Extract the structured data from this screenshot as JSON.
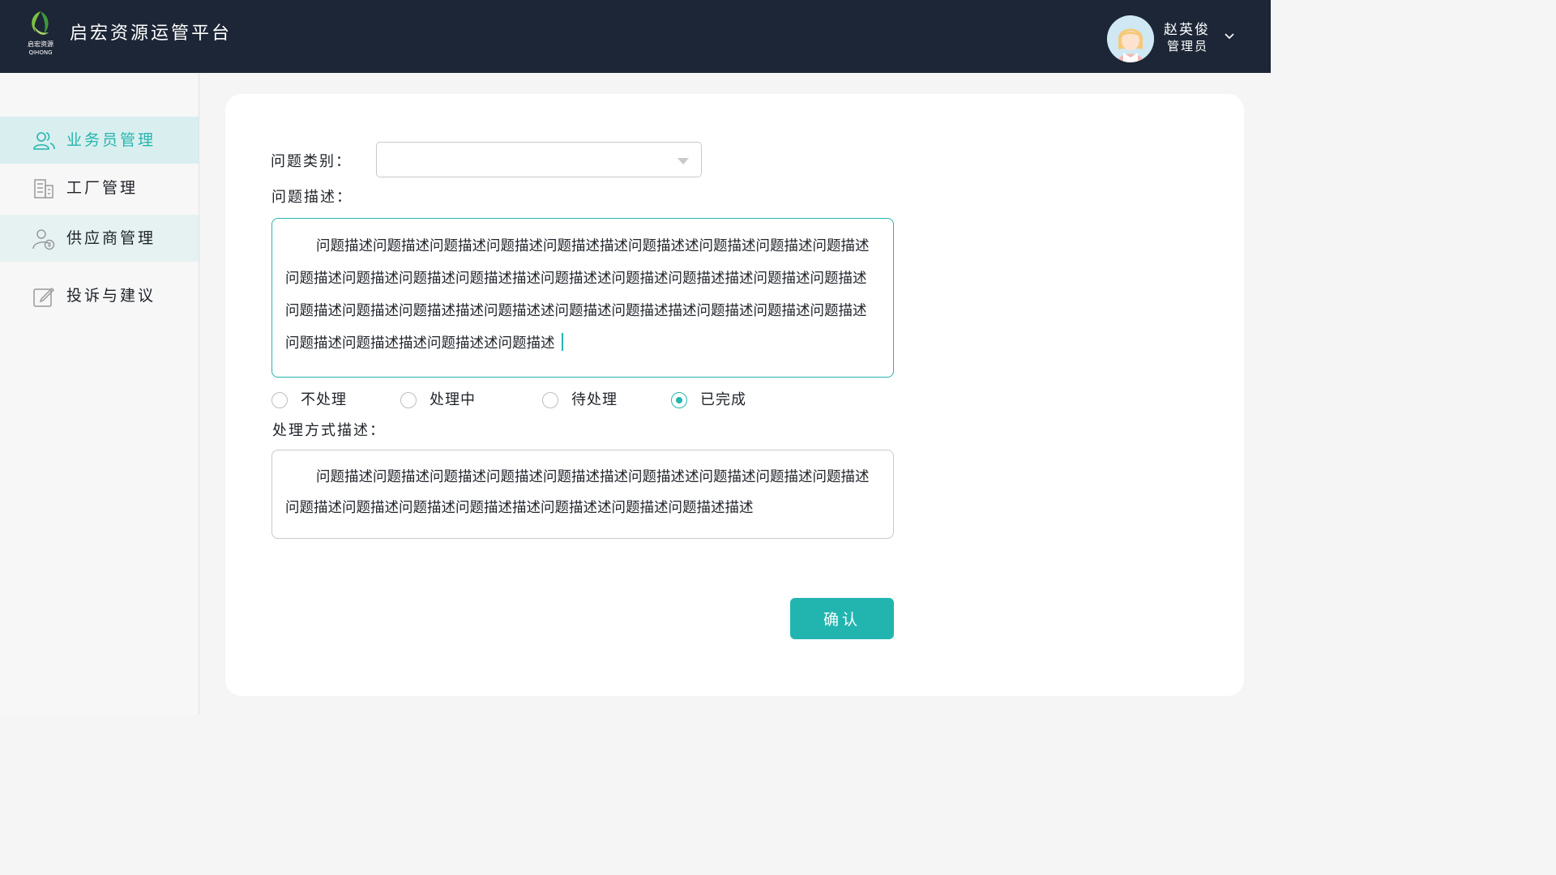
{
  "header": {
    "brand_title": "启宏资源运管平台",
    "logo_text_cn": "启宏资源",
    "logo_text_en": "QIHONG",
    "user_name": "赵英俊",
    "user_role": "管理员",
    "background_color": "#1d2636",
    "avatar_icon": "avatar-girl-icon",
    "dropdown_icon": "chevron-down-icon"
  },
  "sidebar": {
    "items": [
      {
        "label": "业务员管理",
        "icon": "users-icon",
        "state": "active"
      },
      {
        "label": "工厂管理",
        "icon": "building-icon",
        "state": "normal"
      },
      {
        "label": "供应商管理",
        "icon": "supplier-icon",
        "state": "highlighted"
      },
      {
        "label": "投诉与建议",
        "icon": "edit-icon",
        "state": "normal"
      }
    ]
  },
  "form": {
    "category_label": "问题类别：",
    "category_value": "",
    "description_label": "问题描述：",
    "description_text": "问题描述问题描述问题描述问题描述问题描述描述问题描述述问题描述问题描述问题描述问题描述问题描述问题描述问题描述描述问题描述述问题描述问题描述描述问题描述问题描述问题描述问题描述问题描述描述问题描述述问题描述问题描述描述问题描述问题描述问题描述问题描述问题描述描述问题描述述问题描述",
    "status_options": [
      {
        "label": "不处理",
        "checked": false
      },
      {
        "label": "处理中",
        "checked": false
      },
      {
        "label": "待处理",
        "checked": false
      },
      {
        "label": "已完成",
        "checked": true
      }
    ],
    "method_label": "处理方式描述：",
    "method_text": "问题描述问题描述问题描述问题描述问题描述描述问题描述述问题描述问题描述问题描述问题描述问题描述问题描述问题描述描述问题描述述问题描述问题描述描述",
    "confirm_label": "确认"
  },
  "colors": {
    "accent": "#26b4ae",
    "button": "#22b5b0",
    "active_nav_bg": "#d9efef"
  }
}
